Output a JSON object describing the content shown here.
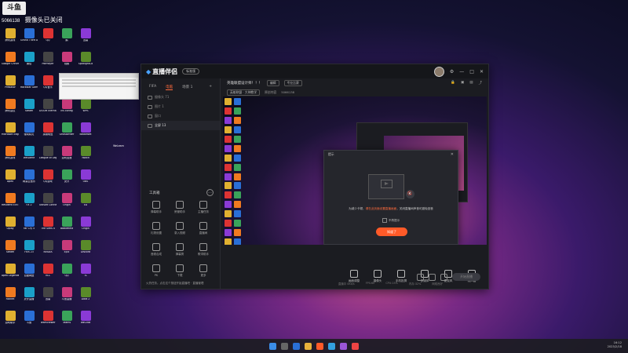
{
  "overlay": {
    "logo_text": "斗鱼",
    "uid": "5066138",
    "camera_status": "摄像头已关闭"
  },
  "app": {
    "name": "直播伴侣",
    "version_badge": "标准版",
    "tabs": [
      "FIFA",
      "电脑",
      "场景 1"
    ],
    "active_tab": "电脑",
    "scenes": [
      {
        "label": "摄像头 71",
        "active": false
      },
      {
        "label": "图片 1",
        "active": false
      },
      {
        "label": "窗口",
        "active": false
      },
      {
        "label": "全屏 13",
        "active": true
      }
    ],
    "tools_title": "工具箱",
    "tools": [
      "弹幕助手",
      "房管助手",
      "主播任务",
      "礼物设置",
      "录入视频",
      "直播间",
      "音频合成",
      "弹幕秀",
      "歌词助手",
      "PK",
      "下载",
      "更多"
    ],
    "side_footer": "火热任务。点击这个按钮开始直播吧 · 直播管理",
    "live_title": "英雄联盟设计师！！！",
    "tag_edit": "编辑",
    "tag_category": "专业比赛",
    "meta_category": "英雄联盟 · 大神教学",
    "meta_status": "原创内容",
    "meta_room": "5066138",
    "modal": {
      "title": "提示",
      "message_prefix": "为减少卡顿，",
      "message_highlight": "请在此页面设置直播画面",
      "message_suffix": "，关闭直播间声音可避免回音",
      "checkbox": "不再提示",
      "ok": "知道了"
    },
    "controls": [
      "画面调整",
      "摄像头",
      "手机投屏",
      "多媒体",
      "麦克风",
      "扬声器"
    ],
    "live_button": "开始直播",
    "status_items": [
      "直播中 0Kb/s",
      "FPS:60",
      "CPU:15%",
      "内存:32%",
      "网络良好"
    ]
  },
  "desktop": {
    "icons": [
      "腾讯游戏",
      "Grand Theft Auto V",
      "QQ",
      "鹅",
      "迅雷",
      "Google Chrome",
      "微信",
      "PotPlayer",
      "视频",
      "SpotlightCo",
      "Predator",
      "Rockstar Games",
      "QQ音乐",
      "Zoom",
      "斗鱼",
      "腾讯会议",
      "Steam",
      "DOOM Eternal",
      "ins config",
      "WPS",
      "Microsoft Edge",
      "驱动精灵",
      "英雄联盟",
      "Ghostwriter",
      "BattleNet",
      "腾讯游戏",
      "WeGame",
      "League of Legends",
      "游戏加速",
      "Twitch",
      "Apex",
      "网易云音乐",
      "QQ游戏",
      "虎牙",
      "OBS",
      "Resident Evil 5",
      "FX 2",
      "Ubisoft Connect",
      "Origin",
      "EA",
      "Uplay",
      "Far Cry 5",
      "The Sims 4",
      "Battlefield",
      "Origin",
      "Steam",
      "FIFA 23",
      "NVIDIA",
      "Epic",
      "Discord",
      "Apex Legends",
      "百度网盘",
      "VLC",
      "QQ",
      "TL",
      "Rocket",
      "虎牙直播",
      "迅雷",
      "斗鱼直播",
      "Dota 2",
      "游戏助手",
      "斗鱼",
      "TeamViewer",
      "Teams",
      "WeChat"
    ],
    "extra_icon": "WeLearn"
  },
  "tray": {
    "time": "16:12",
    "date": "2023/2/18"
  },
  "colors": {
    "accent": "#ff5a28",
    "app_bg": "#1b1c21"
  }
}
